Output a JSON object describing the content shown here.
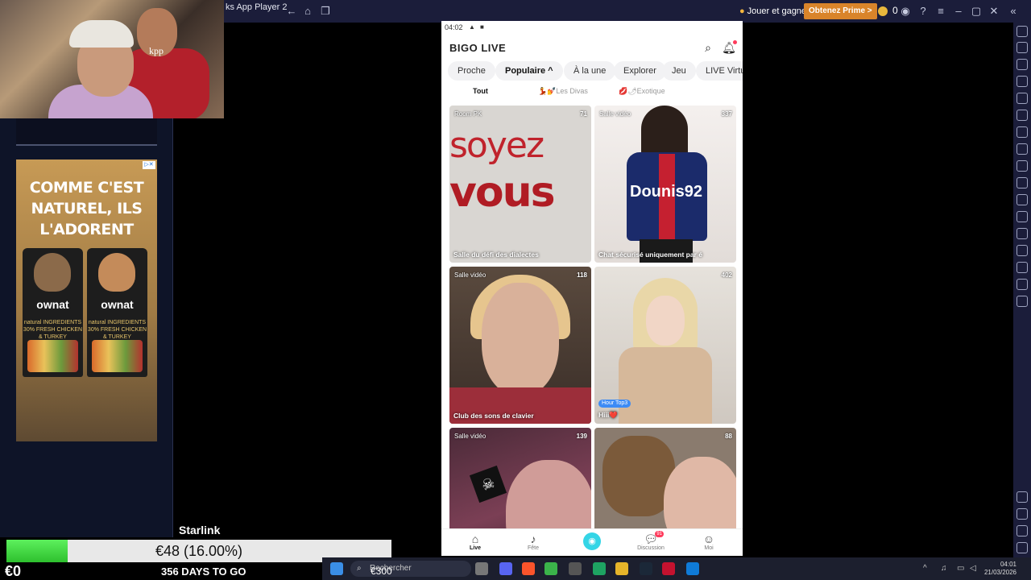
{
  "titlebar": {
    "app_title": "ks App Player 2",
    "jouer_label": "Jouer et gagner",
    "prime_label": "Obtenez Prime >",
    "coins": "0"
  },
  "stream": {
    "webcam_shirt_text": "kpp",
    "ad_text_line1": "COMME C'EST",
    "ad_text_line2": "NATUREL, ILS",
    "ad_text_line3": "L'ADORENT",
    "ad_brand": "ownat",
    "ad_ingredient_1": "natural INGREDIENTS 30% FRESH CHICKEN & TURKEY",
    "ad_ingredient_2": "natural INGREDIENTS 30% FRESH CHICKEN & TURKEY",
    "goal_name": "Starlink",
    "goal_text": "€48 (16.00%)",
    "goal_progress": 0.16,
    "current_amount": "€0",
    "days_text": "356 DAYS TO GO",
    "target_amount": "€300"
  },
  "phone": {
    "status_time": "04:02",
    "logo": "BIGO LIVE",
    "categories": [
      "Proche",
      "Populaire ^",
      "À la une",
      "Explorer",
      "Jeu",
      "LIVE Virtuel"
    ],
    "subtabs": [
      "Tout",
      "💃💅Les Divas",
      "💋🌶Exotique"
    ],
    "cards": [
      {
        "type": "Room PK",
        "viewers": "71",
        "title": "Salle du défi des dialectes",
        "art1": "soyez",
        "art2": "vous"
      },
      {
        "type": "Salle vidéo",
        "viewers": "337",
        "title": "Chat sécurisé uniquement par é",
        "art1": "Dounis92"
      },
      {
        "type": "Salle vidéo",
        "viewers": "118",
        "title": "Club des sons de clavier"
      },
      {
        "type": "",
        "viewers": "402",
        "title": "Hiii❤️",
        "badge": "Hour Top3"
      },
      {
        "type": "Salle vidéo",
        "viewers": "139",
        "title": ""
      },
      {
        "type": "",
        "viewers": "88",
        "title": ""
      }
    ],
    "nav": {
      "live": "Live",
      "fete": "Fête",
      "discussion": "Discussion",
      "discussion_badge": "91",
      "moi": "Moi"
    }
  },
  "taskbar": {
    "search_placeholder": "Rechercher",
    "time": "04:01",
    "date": "21/03/2026"
  }
}
